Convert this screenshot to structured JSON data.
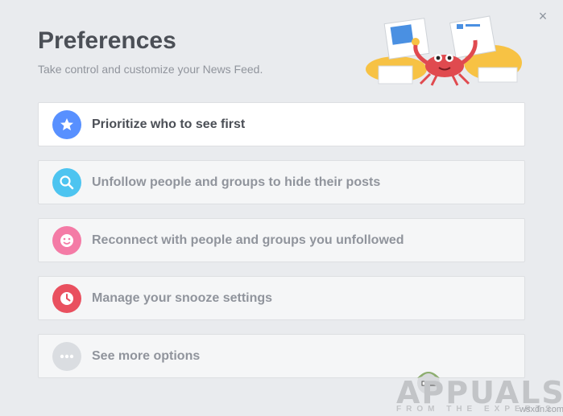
{
  "dialog": {
    "title": "Preferences",
    "subtitle": "Take control and customize your News Feed.",
    "close_icon": "×"
  },
  "options": [
    {
      "label": "Prioritize who to see first",
      "icon": "star-icon",
      "color": "#5890ff",
      "active": true
    },
    {
      "label": "Unfollow people and groups to hide their posts",
      "icon": "search-icon",
      "color": "#4dc4f0",
      "active": false
    },
    {
      "label": "Reconnect with people and groups you unfollowed",
      "icon": "smiley-icon",
      "color": "#f47ba6",
      "active": false
    },
    {
      "label": "Manage your snooze settings",
      "icon": "clock-icon",
      "color": "#e9505f",
      "active": false
    },
    {
      "label": "See more options",
      "icon": "more-icon",
      "color": "#dadde1",
      "active": false
    }
  ],
  "watermark": {
    "text": "APPUALS",
    "tagline": "FROM THE EXPERTS",
    "site": "wsxdn.com"
  }
}
